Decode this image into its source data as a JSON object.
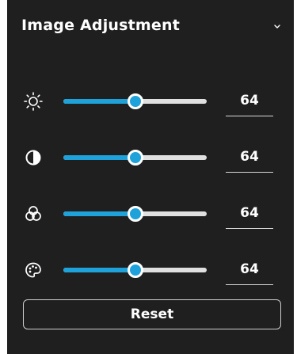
{
  "panel": {
    "title": "Image Adjustment",
    "collapse_icon": "chevron-down-icon",
    "accent_color": "#1fa2d9",
    "background_color": "#1f1f1f"
  },
  "sliders": [
    {
      "name": "brightness",
      "icon": "brightness-icon",
      "value": "64",
      "level": 0.5
    },
    {
      "name": "contrast",
      "icon": "contrast-icon",
      "value": "64",
      "level": 0.5
    },
    {
      "name": "saturation",
      "icon": "color-circles-icon",
      "value": "64",
      "level": 0.5
    },
    {
      "name": "hue",
      "icon": "palette-icon",
      "value": "64",
      "level": 0.5
    }
  ],
  "reset_label": "Reset"
}
